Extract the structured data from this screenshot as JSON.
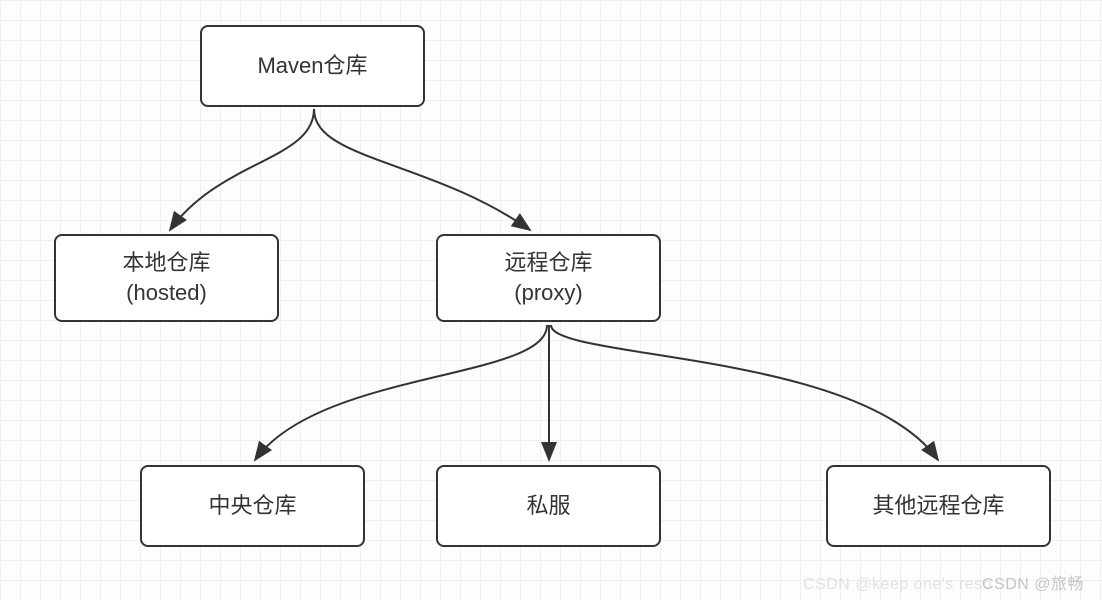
{
  "nodes": {
    "root": {
      "label": "Maven仓库"
    },
    "local": {
      "line1": "本地仓库",
      "line2": "(hosted)"
    },
    "remote": {
      "line1": "远程仓库",
      "line2": "(proxy)"
    },
    "central": {
      "label": "中央仓库"
    },
    "private": {
      "label": "私服"
    },
    "other": {
      "label": "其他远程仓库"
    }
  },
  "chart_data": {
    "type": "tree",
    "title": "Maven仓库",
    "nodes": [
      {
        "id": "root",
        "label": "Maven仓库"
      },
      {
        "id": "local",
        "label": "本地仓库 (hosted)"
      },
      {
        "id": "remote",
        "label": "远程仓库 (proxy)"
      },
      {
        "id": "central",
        "label": "中央仓库"
      },
      {
        "id": "private",
        "label": "私服"
      },
      {
        "id": "other",
        "label": "其他远程仓库"
      }
    ],
    "edges": [
      {
        "from": "root",
        "to": "local"
      },
      {
        "from": "root",
        "to": "remote"
      },
      {
        "from": "remote",
        "to": "central"
      },
      {
        "from": "remote",
        "to": "private"
      },
      {
        "from": "remote",
        "to": "other"
      }
    ]
  },
  "watermark": {
    "left": "CSDN @keep one's reso",
    "right": "CSDN @旅畅"
  }
}
